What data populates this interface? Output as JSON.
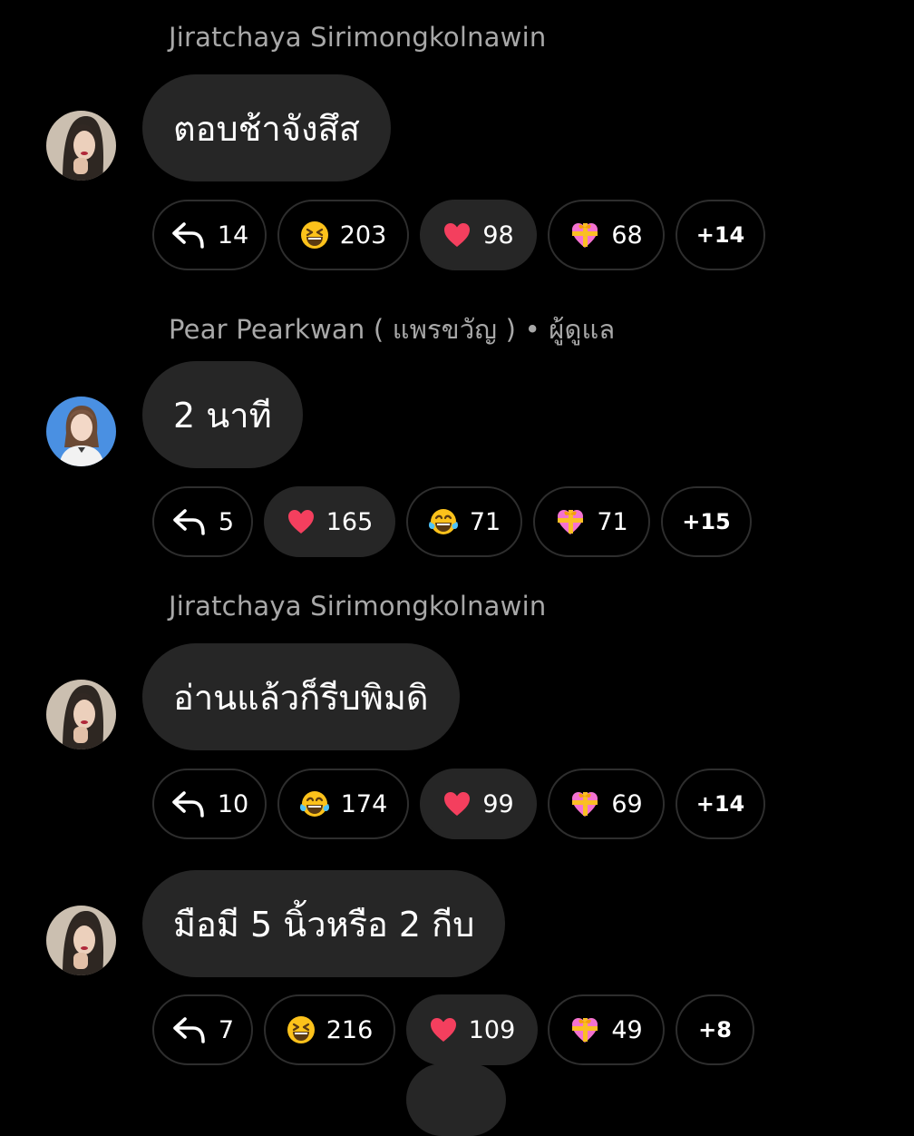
{
  "messages": [
    {
      "sender": "Jiratchaya Sirimongkolnawin",
      "text": "ตอบช้าจังสึส",
      "avatar": "avatar-woman-dark-hair",
      "replies": "14",
      "reactions": [
        {
          "icon": "grinning-squint-emoji",
          "count": "203",
          "active": false
        },
        {
          "icon": "red-heart-emoji",
          "count": "98",
          "active": true
        },
        {
          "icon": "heart-ribbon-emoji",
          "count": "68",
          "active": false
        }
      ],
      "more": "+14"
    },
    {
      "sender": "Pear Pearkwan ( แพรขวัญ ) • ผู้ดูแล",
      "text": "2 นาที",
      "avatar": "avatar-woman-blue-background",
      "replies": "5",
      "reactions": [
        {
          "icon": "red-heart-emoji",
          "count": "165",
          "active": true
        },
        {
          "icon": "tears-of-joy-emoji",
          "count": "71",
          "active": false
        },
        {
          "icon": "heart-ribbon-emoji",
          "count": "71",
          "active": false
        }
      ],
      "more": "+15"
    },
    {
      "sender": "Jiratchaya Sirimongkolnawin",
      "text": "อ่านแล้วก็รีบพิมดิ",
      "avatar": "avatar-woman-dark-hair",
      "replies": "10",
      "reactions": [
        {
          "icon": "tears-of-joy-emoji",
          "count": "174",
          "active": false
        },
        {
          "icon": "red-heart-emoji",
          "count": "99",
          "active": true
        },
        {
          "icon": "heart-ribbon-emoji",
          "count": "69",
          "active": false
        }
      ],
      "more": "+14"
    },
    {
      "sender": "",
      "text": "มือมี 5 นิ้วหรือ 2 กีบ",
      "avatar": "avatar-woman-dark-hair",
      "replies": "7",
      "reactions": [
        {
          "icon": "grinning-squint-emoji",
          "count": "216",
          "active": false
        },
        {
          "icon": "red-heart-emoji",
          "count": "109",
          "active": true
        },
        {
          "icon": "heart-ribbon-emoji",
          "count": "49",
          "active": false
        }
      ],
      "more": "+8"
    }
  ],
  "colors": {
    "background": "#000000",
    "bubble": "#262626",
    "sender": "#a8a8a8",
    "pill_border": "#2e2e2e",
    "heart": "#f43f5e"
  }
}
